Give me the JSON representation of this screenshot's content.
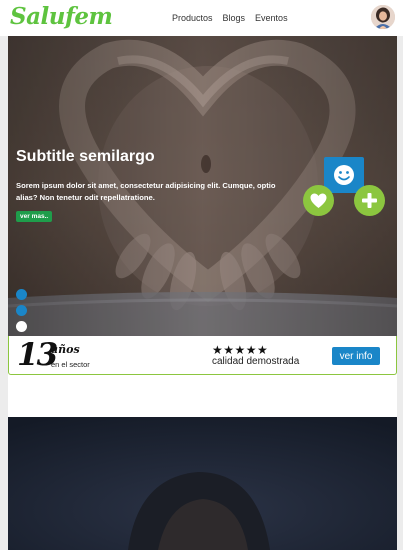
{
  "header": {
    "logo": "Salufem",
    "nav": [
      "Productos",
      "Blogs",
      "Eventos"
    ]
  },
  "hero": {
    "title": "Subtitle semilargo",
    "text": "Sorem ipsum dolor sit amet, consectetur adipisicing elit. Cumque, optio alias? Non tenetur odit repellatratione.",
    "button": "ver mas..",
    "slide_count": 3,
    "active_slide": 3
  },
  "stats": {
    "years_number": "13",
    "years_word": "años",
    "years_sub": "en el sector",
    "stars": "★★★★★",
    "rating_stars": 5,
    "quality": "calidad demostrada",
    "button": "ver info"
  },
  "icons": {
    "smile": "smile-icon",
    "heart": "heart-icon",
    "plus": "plus-icon"
  },
  "colors": {
    "brand_green": "#5ec33f",
    "accent_green": "#8cc63f",
    "accent_blue": "#1a86c8",
    "button_green": "#1f9d4b"
  }
}
